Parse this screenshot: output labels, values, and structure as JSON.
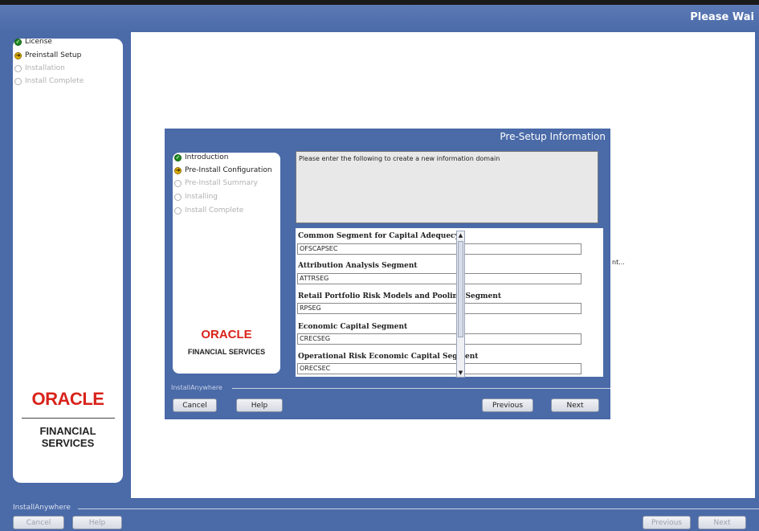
{
  "window": {
    "status_title": "Please Wai"
  },
  "outer_steps": [
    {
      "label": "License",
      "state": "done"
    },
    {
      "label": "Preinstall Setup",
      "state": "current"
    },
    {
      "label": "Installation",
      "state": "pending"
    },
    {
      "label": "Install Complete",
      "state": "pending"
    }
  ],
  "outer_logo": {
    "oracle": "ORACLE",
    "financial": "FINANCIAL SERVICES"
  },
  "outer_footer": {
    "installanywhere": "InstallAnywhere",
    "cancel": "Cancel",
    "help": "Help",
    "previous": "Previous",
    "next": "Next"
  },
  "dialog": {
    "title": "Pre-Setup Information",
    "steps": [
      {
        "label": "Introduction",
        "state": "done"
      },
      {
        "label": "Pre-Install Configuration",
        "state": "current"
      },
      {
        "label": "Pre-Install Summary",
        "state": "pending"
      },
      {
        "label": "Installing",
        "state": "pending"
      },
      {
        "label": "Install Complete",
        "state": "pending"
      }
    ],
    "logo": {
      "oracle": "ORACLE",
      "financial": "FINANCIAL SERVICES"
    },
    "description": "Please enter the following to create a new information domain",
    "fields": [
      {
        "label": "Common Segment for Capital Adequecy",
        "value": "OFSCAPSEC"
      },
      {
        "label": "Attribution Analysis Segment",
        "value": "ATTRSEG"
      },
      {
        "label": "Retail Portfolio Risk Models and Pooling Segment",
        "value": "RPSEG"
      },
      {
        "label": "Economic Capital Segment",
        "value": "CRECSEG"
      },
      {
        "label": "Operational Risk Economic Capital Segment",
        "value": "ORECSEC"
      }
    ],
    "footer": {
      "installanywhere": "InstallAnywhere",
      "cancel": "Cancel",
      "help": "Help",
      "previous": "Previous",
      "next": "Next"
    }
  },
  "stray_text": "nt..."
}
